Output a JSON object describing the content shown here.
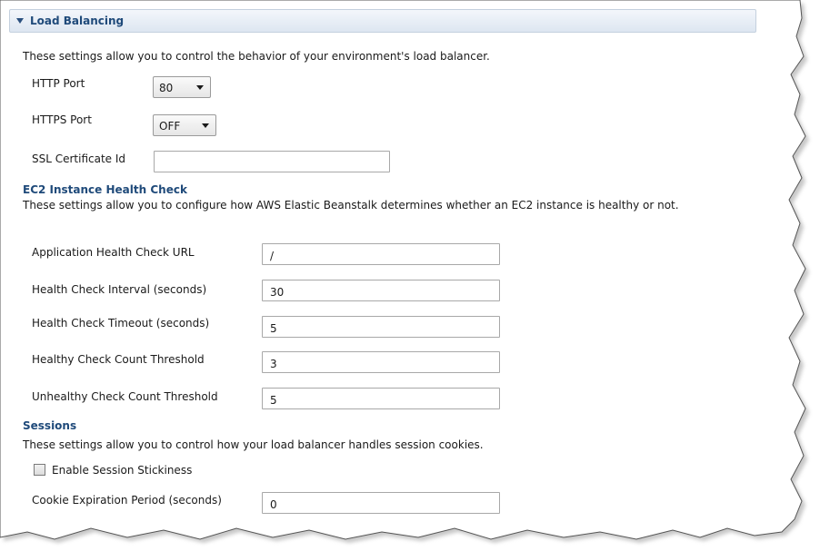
{
  "colors": {
    "section_title": "#1f4a7a",
    "header_gradient_top": "#f3f6fb",
    "header_gradient_bottom": "#dde6f1"
  },
  "load_balancing": {
    "title": "Load Balancing",
    "expanded_icon": "triangle-down-icon",
    "description": "These settings allow you to control the behavior of your environment's load balancer.",
    "http_port": {
      "label": "HTTP Port",
      "value": "80"
    },
    "https_port": {
      "label": "HTTPS Port",
      "value": "OFF"
    },
    "ssl_certificate": {
      "label": "SSL Certificate Id",
      "value": ""
    }
  },
  "health_check": {
    "title": "EC2 Instance Health Check",
    "description": "These settings allow you to configure how AWS Elastic Beanstalk determines whether an EC2 instance is healthy or not.",
    "fields": [
      {
        "label": "Application Health Check URL",
        "value": "/"
      },
      {
        "label": "Health Check Interval (seconds)",
        "value": "30"
      },
      {
        "label": "Health Check Timeout (seconds)",
        "value": "5"
      },
      {
        "label": "Healthy Check Count Threshold",
        "value": "3"
      },
      {
        "label": "Unhealthy Check Count Threshold",
        "value": "5"
      }
    ]
  },
  "sessions": {
    "title": "Sessions",
    "description": "These settings allow you to control how your load balancer handles session cookies.",
    "stickiness": {
      "label": "Enable Session Stickiness",
      "checked": false
    },
    "cookie_expiration": {
      "label": "Cookie Expiration Period (seconds)",
      "value": "0"
    }
  }
}
